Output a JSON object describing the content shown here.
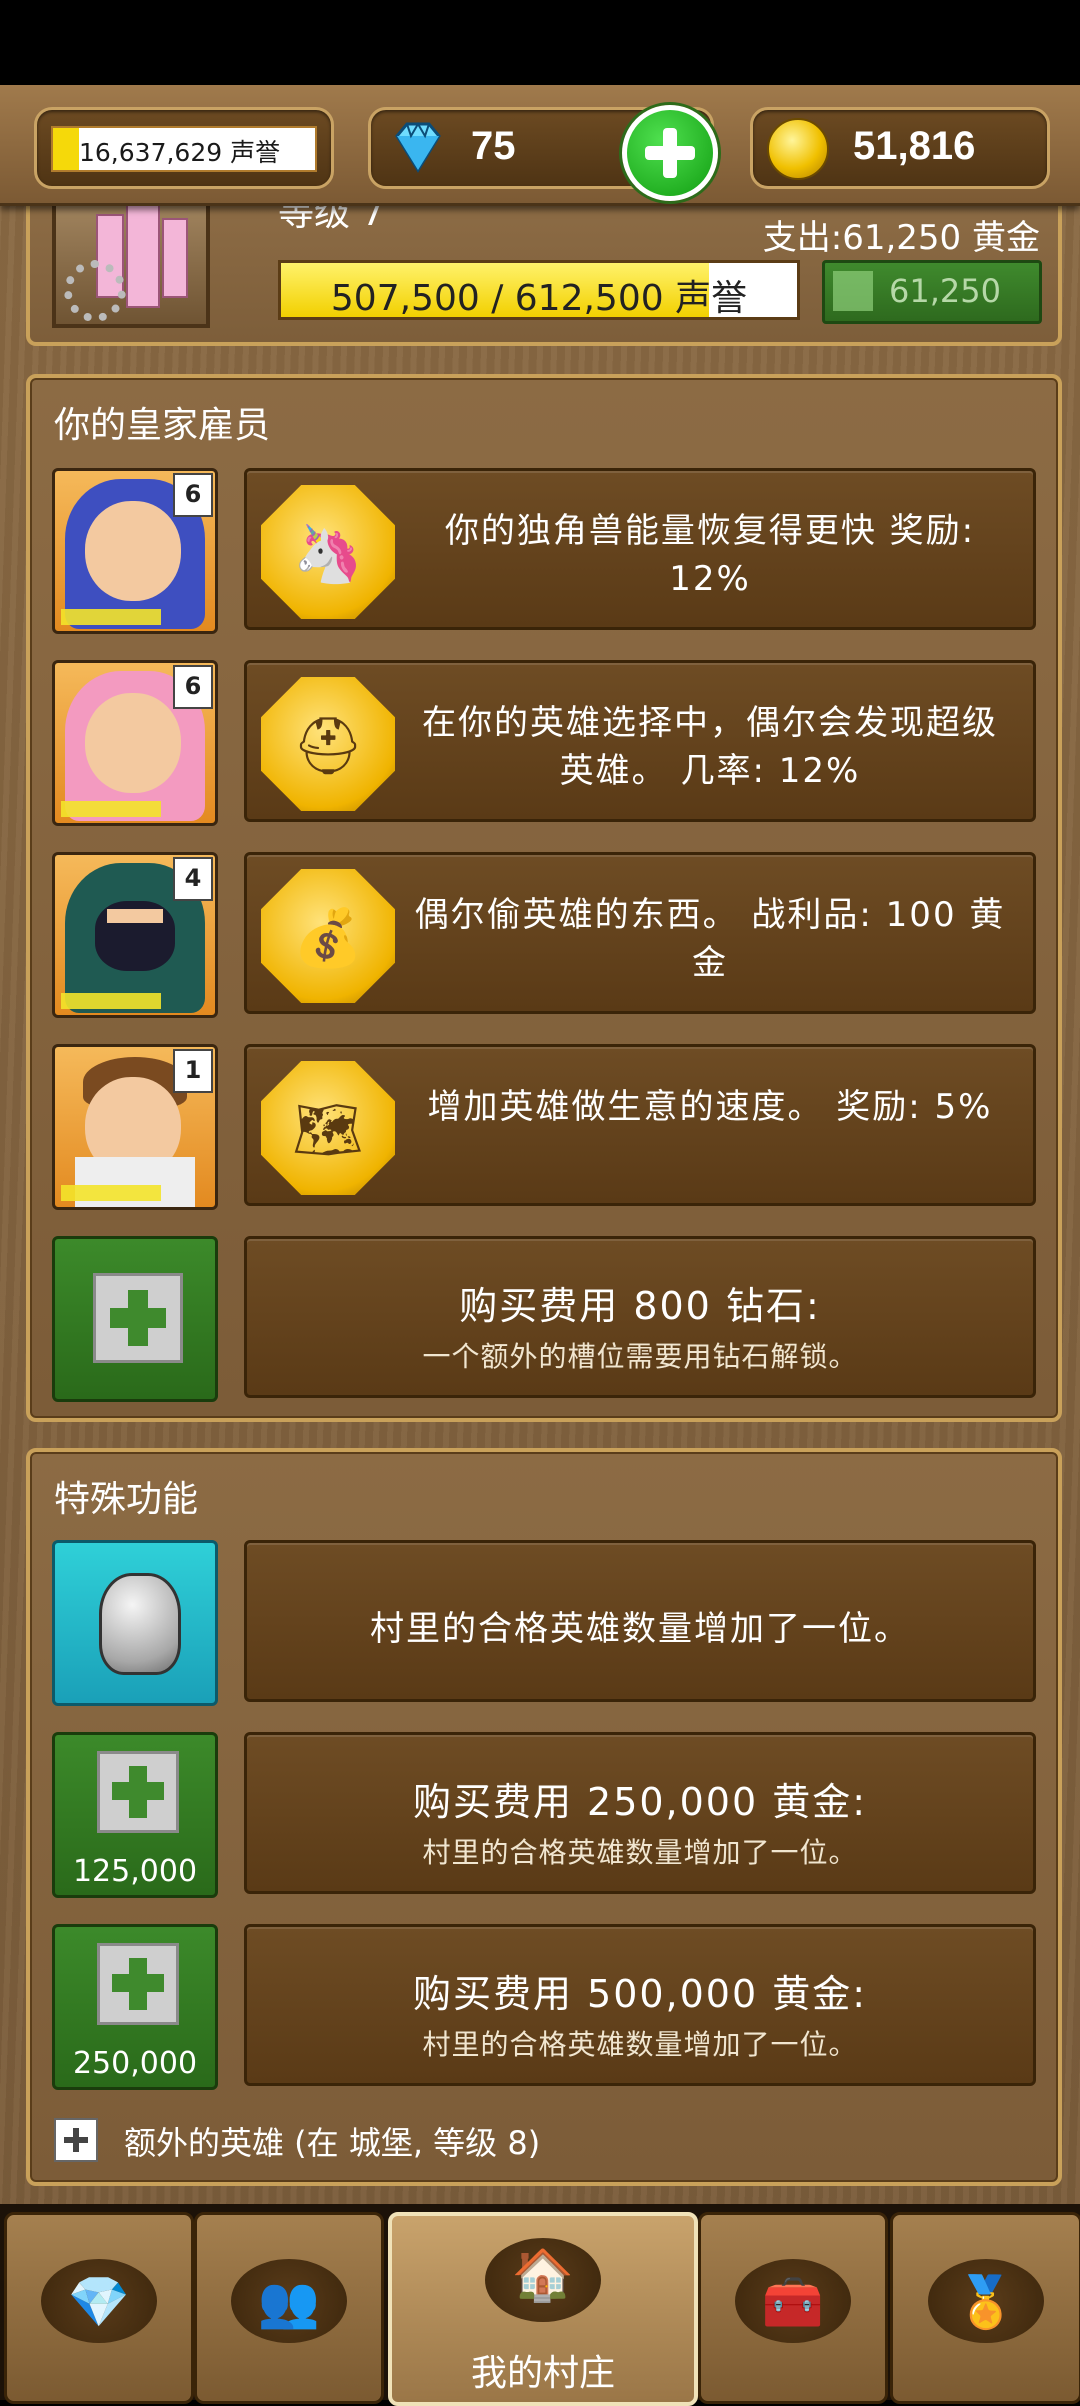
{
  "resources": {
    "reputation": "16,637,629 声誉",
    "reputation_fill": 0.1,
    "gems": "75",
    "gold": "51,816"
  },
  "castle": {
    "level": "等级 7",
    "cost": "支出:61,250 黄金",
    "progress_text": "507,500 / 612,500 声誉",
    "progress_fraction": 0.83,
    "upgrade_price": "61,250"
  },
  "employees": {
    "title": "你的皇家雇员",
    "items": [
      {
        "level": "6",
        "text": "你的独角兽能量恢复得更快 奖励: 12%",
        "icon": "unicorn-icon"
      },
      {
        "level": "6",
        "text": "在你的英雄选择中，偶尔会发现超级英雄。 几率: 12%",
        "icon": "helmet-icon"
      },
      {
        "level": "4",
        "text": "偶尔偷英雄的东西。 战利品: 100 黄金",
        "icon": "money-bag-icon"
      },
      {
        "level": "1",
        "text": "增加英雄做生意的速度。 奖励: 5%",
        "icon": "map-icon"
      }
    ],
    "buy_slot": {
      "main": "购买费用 800 钻石:",
      "sub": "一个额外的槽位需要用钻石解锁。"
    }
  },
  "special": {
    "title": "特殊功能",
    "items": [
      {
        "main": "村里的合格英雄数量增加了一位。"
      },
      {
        "price": "125,000",
        "main": "购买费用 250,000 黄金:",
        "sub": "村里的合格英雄数量增加了一位。"
      },
      {
        "price": "250,000",
        "main": "购买费用 500,000 黄金:",
        "sub": "村里的合格英雄数量增加了一位。"
      }
    ],
    "extra_hero": "额外的英雄 (在 城堡, 等级 8)"
  },
  "nav": {
    "village_label": "我的村庄"
  },
  "colors": {
    "wood": "#7c5c38",
    "accent_gold": "#f2d000",
    "green": "#3c8a2a"
  }
}
